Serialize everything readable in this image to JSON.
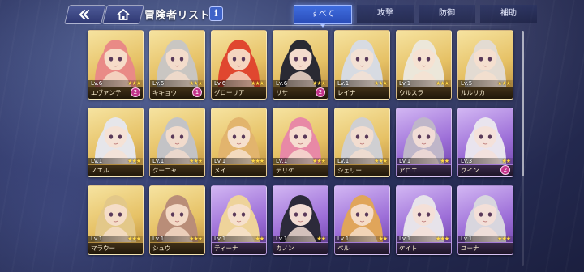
{
  "header": {
    "title": "冒険者リスト",
    "info_label": "i",
    "back_icon": "back-arrow-icon",
    "home_icon": "home-icon"
  },
  "tabs": [
    {
      "label": "すべて",
      "active": true
    },
    {
      "label": "攻撃",
      "active": false
    },
    {
      "label": "防御",
      "active": false
    },
    {
      "label": "補助",
      "active": false
    }
  ],
  "colors": {
    "accent": "#3f6ee0",
    "gold_frame": "#e6c165",
    "purple_frame": "#9d6fd8",
    "badge": "#c2348a",
    "star": "#ffd84a"
  },
  "adventurers": [
    {
      "name": "エヴァンテ",
      "level": "Lv.6",
      "stars": "★★★",
      "badge": "2",
      "frame": "gold",
      "hair": "#e98a86",
      "skin": "#f6dcc8"
    },
    {
      "name": "キキョウ",
      "level": "Lv.6",
      "stars": "★★★",
      "badge": "1",
      "frame": "gold",
      "hair": "#c9c6c2",
      "skin": "#f3dccb"
    },
    {
      "name": "グローリア",
      "level": "Lv.6",
      "stars": "★★★",
      "badge": "",
      "frame": "gold",
      "hair": "#e0472f",
      "skin": "#f5d6c0"
    },
    {
      "name": "リサ",
      "level": "Lv.6",
      "stars": "★★★",
      "badge": "2",
      "frame": "gold",
      "hair": "#2a2a33",
      "skin": "#f4dccd"
    },
    {
      "name": "レイナ",
      "level": "Lv.1",
      "stars": "★★★",
      "badge": "",
      "frame": "gold",
      "hair": "#d7dbe2",
      "skin": "#f3e1d4"
    },
    {
      "name": "ウルスラ",
      "level": "Lv.1",
      "stars": "★★★",
      "badge": "",
      "frame": "gold",
      "hair": "#ece7da",
      "skin": "#f6e2d2"
    },
    {
      "name": "ルルリカ",
      "level": "Lv.5",
      "stars": "★★★",
      "badge": "",
      "frame": "gold",
      "hair": "#e3dbd2",
      "skin": "#f5dfcf"
    },
    {
      "name": "ノエル",
      "level": "Lv.1",
      "stars": "★★★",
      "badge": "",
      "frame": "gold",
      "hair": "#e6e6ea",
      "skin": "#f5e2d6"
    },
    {
      "name": "クーニャ",
      "level": "Lv.1",
      "stars": "★★★",
      "badge": "",
      "frame": "gold",
      "hair": "#c3c3c6",
      "skin": "#f1dbcc"
    },
    {
      "name": "メイ",
      "level": "Lv.1",
      "stars": "★★★",
      "badge": "",
      "frame": "gold",
      "hair": "#e2b46d",
      "skin": "#f6e0cd"
    },
    {
      "name": "デリケ",
      "level": "Lv.1",
      "stars": "★★★",
      "badge": "",
      "frame": "gold",
      "hair": "#e889a6",
      "skin": "#f6ddd0"
    },
    {
      "name": "シェリー",
      "level": "Lv.1",
      "stars": "★★★",
      "badge": "",
      "frame": "gold",
      "hair": "#cfcfd2",
      "skin": "#f2ddd0"
    },
    {
      "name": "アロエ",
      "level": "Lv.1",
      "stars": "★★",
      "badge": "",
      "frame": "purple",
      "hair": "#bfb6c9",
      "skin": "#f1dcd6"
    },
    {
      "name": "クイン",
      "level": "Lv.3",
      "stars": "★★",
      "badge": "2",
      "frame": "purple",
      "hair": "#e9e4ee",
      "skin": "#f4e1da"
    },
    {
      "name": "マラウー",
      "level": "Lv.1",
      "stars": "★★★",
      "badge": "",
      "frame": "gold",
      "hair": "#e3c889",
      "skin": "#f5ddc8"
    },
    {
      "name": "シュウ",
      "level": "Lv.1",
      "stars": "★★★",
      "badge": "",
      "frame": "gold",
      "hair": "#b98d78",
      "skin": "#f3d9c6"
    },
    {
      "name": "ティーナ",
      "level": "Lv.1",
      "stars": "★★",
      "badge": "",
      "frame": "purple",
      "hair": "#eed39a",
      "skin": "#f6e0cd"
    },
    {
      "name": "カノン",
      "level": "Lv.1",
      "stars": "★★",
      "badge": "",
      "frame": "purple",
      "hair": "#2c2a3a",
      "skin": "#f2dcd3"
    },
    {
      "name": "ベル",
      "level": "Lv.1",
      "stars": "★★",
      "badge": "",
      "frame": "purple",
      "hair": "#e0a55a",
      "skin": "#f5dcc7"
    },
    {
      "name": "ケイト",
      "level": "Lv.1",
      "stars": "★★★",
      "badge": "",
      "frame": "purple",
      "hair": "#e7e3ea",
      "skin": "#f4e0d8"
    },
    {
      "name": "ユーナ",
      "level": "Lv.1",
      "stars": "★★★",
      "badge": "",
      "frame": "purple",
      "hair": "#d8d6de",
      "skin": "#f3dfd8"
    }
  ],
  "scroll": {
    "position": 0
  }
}
